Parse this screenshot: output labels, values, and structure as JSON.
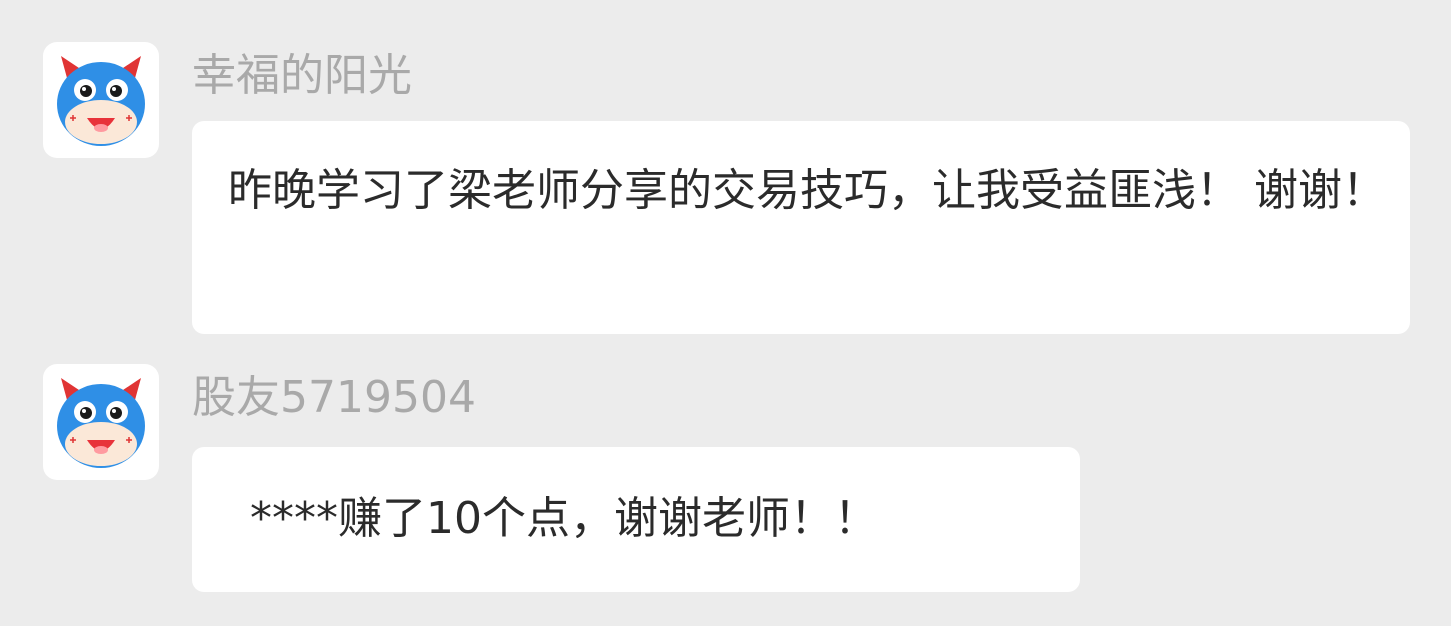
{
  "messages": [
    {
      "avatar_icon": "cartoon-bull-icon",
      "username": "幸福的阳光",
      "text": "昨晚学习了梁老师分享的交易技巧，让我受益匪浅！ 谢谢！"
    },
    {
      "avatar_icon": "cartoon-bull-icon",
      "username": "股友5719504",
      "text": "****赚了10个点，谢谢老师！！"
    }
  ],
  "colors": {
    "background": "#ececec",
    "bubble": "#ffffff",
    "username": "#a9a9a9",
    "message_text": "#2b2b2b",
    "avatar_head": "#2f8fe6",
    "avatar_horn": "#e03434",
    "avatar_mouth": "#e8323a"
  }
}
